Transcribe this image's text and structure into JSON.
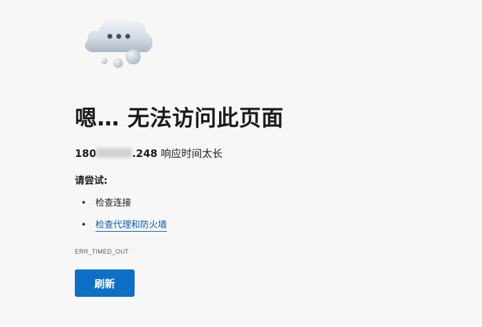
{
  "error_page": {
    "title": "嗯… 无法访问此页面",
    "subtitle": {
      "host_start": "180",
      "host_end": ".248",
      "message": " 响应时间太长"
    },
    "try_heading": "请尝试:",
    "suggestions": [
      {
        "label": "检查连接",
        "link": false
      },
      {
        "label": "检查代理和防火墙",
        "link": true
      }
    ],
    "error_code": "ERR_TIMED_OUT",
    "refresh_label": "刷新",
    "bullet": "•"
  },
  "colors": {
    "background": "#f7f7f7",
    "primary_button": "#0e6fc7",
    "link": "#0a5ea8"
  },
  "icons": {
    "illustration": "cloud-with-dots-icon"
  }
}
